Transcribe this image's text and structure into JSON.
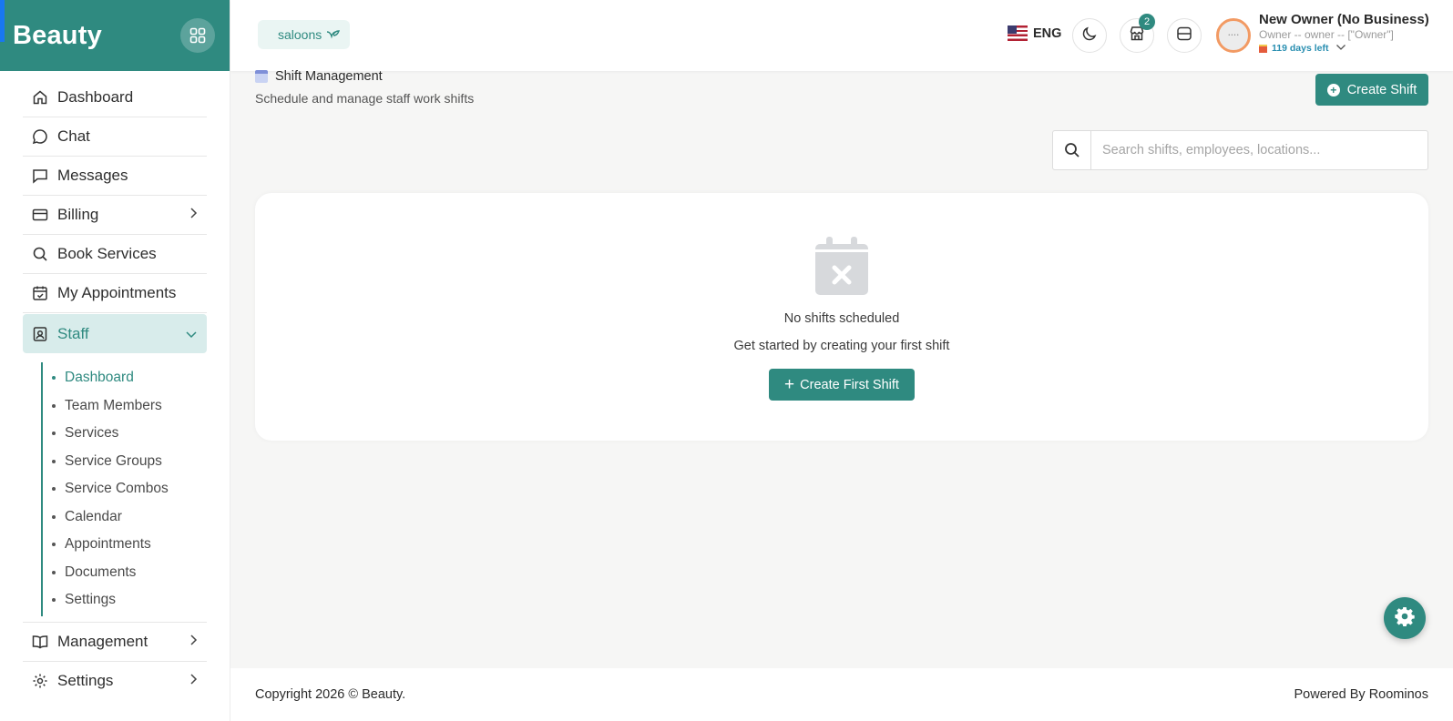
{
  "brand": {
    "name": "Beauty"
  },
  "sidebar": {
    "items": [
      {
        "label": "Dashboard",
        "icon": "home-icon"
      },
      {
        "label": "Chat",
        "icon": "chat-icon"
      },
      {
        "label": "Messages",
        "icon": "message-icon"
      },
      {
        "label": "Billing",
        "icon": "card-icon",
        "expandable": true
      },
      {
        "label": "Book Services",
        "icon": "search-icon"
      },
      {
        "label": "My Appointments",
        "icon": "calendar-check-icon"
      },
      {
        "label": "Staff",
        "icon": "staff-badge-icon",
        "expanded": true,
        "active": true
      }
    ],
    "staff_subitems": [
      {
        "label": "Dashboard",
        "active": true
      },
      {
        "label": "Team Members"
      },
      {
        "label": "Services"
      },
      {
        "label": "Service Groups"
      },
      {
        "label": "Service Combos"
      },
      {
        "label": "Calendar"
      },
      {
        "label": "Appointments"
      },
      {
        "label": "Documents"
      },
      {
        "label": "Settings"
      }
    ],
    "bottom_items": [
      {
        "label": "Management",
        "icon": "book-icon",
        "expandable": true
      },
      {
        "label": "Settings",
        "icon": "gear-icon",
        "expandable": true
      }
    ]
  },
  "topbar": {
    "business_chip": "saloons",
    "language": "ENG",
    "notification_count": "2",
    "user": {
      "name": "New Owner (No Business)",
      "role": "Owner -- owner -- [\"Owner\"]",
      "days_left": "119 days left"
    }
  },
  "page": {
    "title": "Shift Management",
    "subtitle": "Schedule and manage staff work shifts",
    "create_button": "Create Shift",
    "search_placeholder": "Search shifts, employees, locations..."
  },
  "empty_state": {
    "title": "No shifts scheduled",
    "subtitle": "Get started by creating your first shift",
    "button": "Create First Shift"
  },
  "footer": {
    "copyright": "Copyright 2026 © Beauty.",
    "powered": "Powered By Roominos"
  },
  "colors": {
    "accent": "#2f8a80",
    "accent_light": "#d8eceb",
    "background": "#f6f6f5"
  }
}
